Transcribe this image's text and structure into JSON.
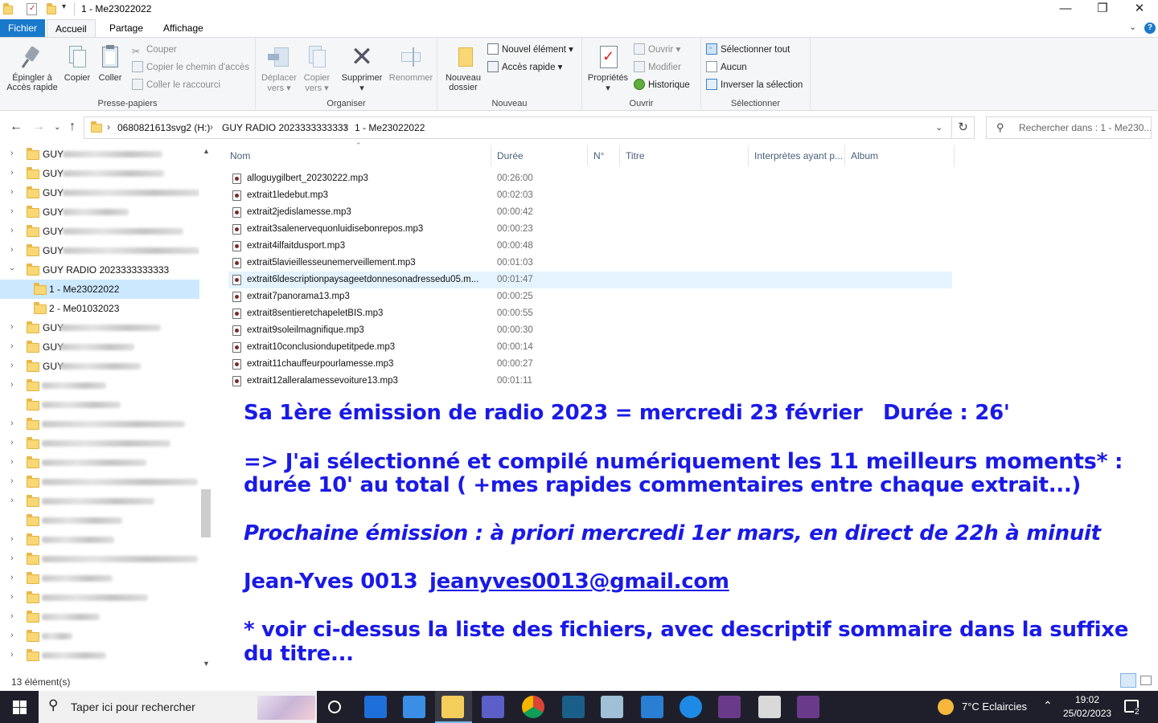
{
  "window": {
    "title": "1 - Me23022022"
  },
  "ribbon_tabs": [
    "Fichier",
    "Accueil",
    "Partage",
    "Affichage"
  ],
  "ribbon": {
    "presse_papiers": {
      "label": "Presse-papiers",
      "epingler": "Épingler à",
      "epingler2": "Accès rapide",
      "copier": "Copier",
      "coller": "Coller",
      "couper": "Couper",
      "copier_chemin": "Copier le chemin d'accès",
      "coller_raccourci": "Coller le raccourci"
    },
    "organiser": {
      "label": "Organiser",
      "deplacer": "Déplacer",
      "deplacer2": "vers",
      "copier_vers": "Copier",
      "copier_vers2": "vers",
      "supprimer": "Supprimer",
      "renommer": "Renommer"
    },
    "nouveau": {
      "label": "Nouveau",
      "nouveau_dossier": "Nouveau",
      "nouveau_dossier2": "dossier",
      "nouvel_element": "Nouvel élément",
      "acces_rapide": "Accès rapide"
    },
    "ouvrir": {
      "label": "Ouvrir",
      "proprietes": "Propriétés",
      "ouvrir": "Ouvrir",
      "modifier": "Modifier",
      "historique": "Historique"
    },
    "selectionner": {
      "label": "Sélectionner",
      "tout": "Sélectionner tout",
      "aucun": "Aucun",
      "inverser": "Inverser la sélection"
    }
  },
  "address": {
    "crumbs": [
      "0680821613svg2 (H:)",
      "GUY RADIO 2023333333333",
      "1 - Me23022022"
    ],
    "search_placeholder": "Rechercher dans : 1 - Me230..."
  },
  "nav_tree": {
    "guy": "GUY",
    "guy_radio": "GUY RADIO 2023333333333",
    "child1": "1 - Me23022022",
    "child2": "2 - Me01032023"
  },
  "columns": [
    "Nom",
    "Durée",
    "N°",
    "Titre",
    "Interprètes ayant p...",
    "Album"
  ],
  "files": [
    {
      "name": "alloguygilbert_20230222.mp3",
      "duration": "00:26:00"
    },
    {
      "name": "extrait1ledebut.mp3",
      "duration": "00:02:03"
    },
    {
      "name": "extrait2jedislamesse.mp3",
      "duration": "00:00:42"
    },
    {
      "name": "extrait3salenervequonluidisebonrepos.mp3",
      "duration": "00:00:23"
    },
    {
      "name": "extrait4ilfaitdusport.mp3",
      "duration": "00:00:48"
    },
    {
      "name": "extrait5lavieillesseunemerveillement.mp3",
      "duration": "00:01:03"
    },
    {
      "name": "extrait6ldescriptionpaysageetdonnesonadressedu05.m...",
      "duration": "00:01:47"
    },
    {
      "name": "extrait7panorama13.mp3",
      "duration": "00:00:25"
    },
    {
      "name": "extrait8sentieretchapeletBIS.mp3",
      "duration": "00:00:55"
    },
    {
      "name": "extrait9soleilmagnifique.mp3",
      "duration": "00:00:30"
    },
    {
      "name": "extrait10conclusiondupetitpede.mp3",
      "duration": "00:00:14"
    },
    {
      "name": "extrait11chauffeurpourlamesse.mp3",
      "duration": "00:00:27"
    },
    {
      "name": "extrait12alleralamessevoiture13.mp3",
      "duration": "00:01:11"
    }
  ],
  "overlay": {
    "line1a": "Sa 1ère émission de radio 2023 = mercredi 23 février",
    "line1b": "Durée : 26'",
    "line2a": "=> J'ai sélectionné et compilé numériquement ",
    "line2b": "les 11 meilleurs moments*",
    "line2c": "  :",
    "line3a": "durée 10' au total",
    "line3b": " ( +mes rapides commentaires entre chaque extrait...)",
    "line4": "Prochaine émission : à priori mercredi 1er mars, en direct de 22h à minuit",
    "line5a": "Jean-Yves 0013",
    "line5b": " jeanyves0013@gmail.com ",
    "line6": "* voir ci-dessus la liste des fichiers, avec descriptif sommaire dans la suffixe",
    "line7": "du titre..."
  },
  "status": {
    "count": "13 élément(s)"
  },
  "taskbar": {
    "search": "Taper ici pour rechercher",
    "weather": "7°C  Eclaircies",
    "time": "19:02",
    "date": "25/02/2023",
    "notif_count": "2"
  },
  "colors": {
    "accent": "#1979ca",
    "overlay_text": "#1a1ae6",
    "selection": "#cce8ff"
  }
}
